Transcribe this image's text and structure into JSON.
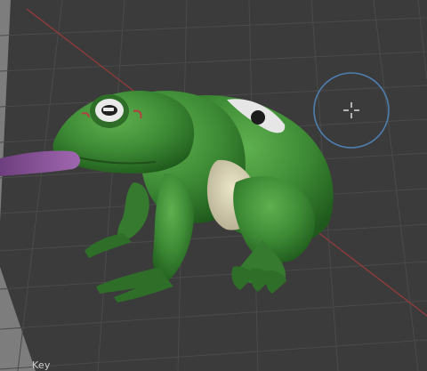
{
  "viewport": {
    "status_text": "Key",
    "colors": {
      "background": "#3b3b3b",
      "grid_line": "#4a4a4a",
      "x_axis": "#9a3b3b",
      "gizmo_ring": "#4d7fb0",
      "frog_skin": "#3d8a35",
      "frog_belly": "#d9d2b3",
      "tongue": "#8a4d9a"
    },
    "icons": [
      "rotate-gizmo-icon",
      "crosshair-cursor-icon"
    ]
  }
}
